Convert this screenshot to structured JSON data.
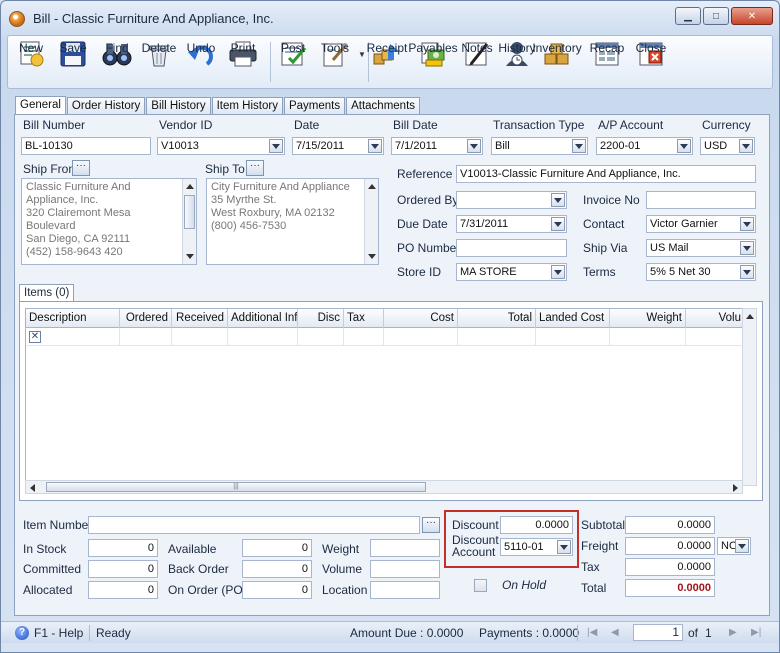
{
  "window": {
    "title": "Bill - Classic Furniture And Appliance, Inc."
  },
  "toolbar": {
    "new": "New",
    "save": "Save",
    "find": "Find",
    "delete": "Delete",
    "undo": "Undo",
    "print": "Print",
    "post": "Post",
    "tools": "Tools",
    "receipt": "Receipt",
    "payables": "Payables",
    "notes": "Notes",
    "history": "History",
    "inventory": "Inventory",
    "recap": "Recap",
    "close": "Close"
  },
  "tabs": [
    "General",
    "Order History",
    "Bill History",
    "Item History",
    "Payments",
    "Attachments"
  ],
  "header": {
    "bill_number_label": "Bill Number",
    "bill_number": "BL-10130",
    "vendor_id_label": "Vendor ID",
    "vendor_id": "V10013",
    "date_label": "Date",
    "date": "7/15/2011",
    "bill_date_label": "Bill Date",
    "bill_date": "7/1/2011",
    "transaction_type_label": "Transaction Type",
    "transaction_type": "Bill",
    "ap_account_label": "A/P Account",
    "ap_account": "2200-01",
    "currency_label": "Currency",
    "currency": "USD"
  },
  "ship_from": {
    "label": "Ship From",
    "lines": [
      "Classic Furniture And",
      "Appliance, Inc.",
      "320 Clairemont Mesa",
      "Boulevard",
      "San Diego, CA 92111",
      "(452) 158-9643 420"
    ]
  },
  "ship_to": {
    "label": "Ship To",
    "lines": [
      "City Furniture And Appliance",
      "35 Myrthe St.",
      "West Roxbury, MA 02132",
      "(800) 456-7530"
    ]
  },
  "details": {
    "reference_label": "Reference",
    "reference": "V10013-Classic Furniture And Appliance, Inc.",
    "ordered_by_label": "Ordered By",
    "ordered_by": "",
    "invoice_no_label": "Invoice No",
    "invoice_no": "",
    "due_date_label": "Due Date",
    "due_date": "7/31/2011",
    "contact_label": "Contact",
    "contact": "Victor Garnier",
    "po_number_label": "PO Number",
    "po_number": "",
    "ship_via_label": "Ship Via",
    "ship_via": "US Mail",
    "store_id_label": "Store ID",
    "store_id": "MA STORE",
    "terms_label": "Terms",
    "terms": "5% 5 Net 30"
  },
  "items": {
    "tab_label": "Items (0)",
    "columns": [
      "Description",
      "Ordered",
      "Received",
      "Additional Inf",
      "Disc",
      "Tax",
      "Cost",
      "Total",
      "Landed Cost",
      "Weight",
      "Volu"
    ],
    "delete_glyph": "✕"
  },
  "item_info": {
    "item_number_label": "Item Number",
    "item_number": "",
    "in_stock_label": "In Stock",
    "in_stock": "0",
    "committed_label": "Committed",
    "committed": "0",
    "allocated_label": "Allocated",
    "allocated": "0",
    "available_label": "Available",
    "available": "0",
    "back_order_label": "Back Order",
    "back_order": "0",
    "on_order_label": "On Order (PO)",
    "on_order": "0",
    "weight_label": "Weight",
    "weight": "",
    "volume_label": "Volume",
    "volume": "",
    "location_label": "Location",
    "location": ""
  },
  "discount": {
    "label": "Discount",
    "value": "0.0000",
    "account_label_1": "Discount",
    "account_label_2": "Account",
    "account": "5110-01"
  },
  "on_hold_label": "On Hold",
  "totals": {
    "subtotal_label": "Subtotal",
    "subtotal": "0.0000",
    "freight_label": "Freight",
    "freight": "0.0000",
    "freight_option": "NO",
    "tax_label": "Tax",
    "tax": "0.0000",
    "total_label": "Total",
    "total": "0.0000"
  },
  "status": {
    "help": "F1 - Help",
    "state": "Ready",
    "amount_due": "Amount Due : 0.0000",
    "payments": "Payments : 0.0000",
    "page": "1",
    "of_label": "of",
    "page_total": "1"
  },
  "colors": {
    "accent": "#1f4fc4",
    "highlight_border": "#c3302a",
    "total_text": "#a0161c"
  }
}
